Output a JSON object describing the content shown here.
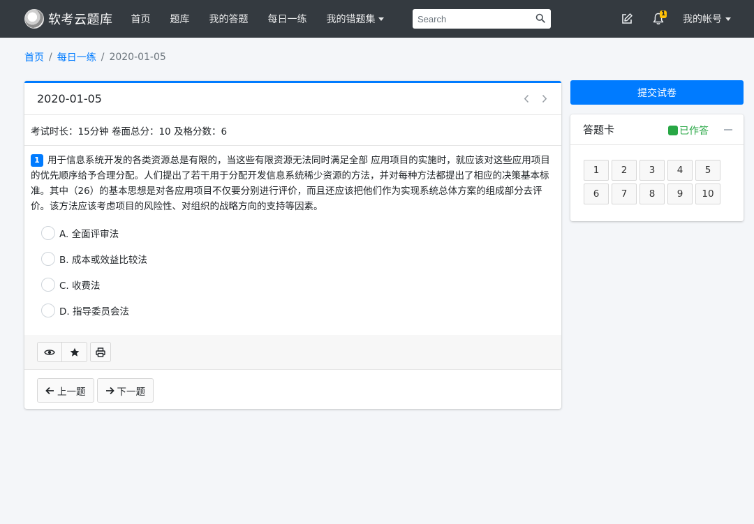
{
  "brand": {
    "name": "软考云题库"
  },
  "nav": [
    {
      "label": "首页"
    },
    {
      "label": "题库"
    },
    {
      "label": "我的答题"
    },
    {
      "label": "每日一练"
    },
    {
      "label": "我的错题集",
      "dropdown": true
    }
  ],
  "search": {
    "placeholder": "Search",
    "value": ""
  },
  "notifications": {
    "count": "1"
  },
  "account": {
    "label": "我的帐号"
  },
  "breadcrumb": [
    {
      "label": "首页"
    },
    {
      "label": "每日一练"
    },
    {
      "label": "2020-01-05"
    }
  ],
  "exam": {
    "title": "2020-01-05",
    "info": "考试时长：15分钟 卷面总分：10 及格分数：6"
  },
  "question": {
    "number": "1",
    "text": "用于信息系统开发的各类资源总是有限的，当这些有限资源无法同时满足全部 应用项目的实施时，就应该对这些应用项目的优先顺序给予合理分配。人们提出了若干用于分配开发信息系统稀少资源的方法，并对每种方法都提出了相应的决策基本标准。其中（26）的基本思想是对各应用项目不仅要分别进行评价，而且还应该把他们作为实现系统总体方案的组成部分去评价。该方法应该考虑项目的风险性、对组织的战略方向的支持等因素。",
    "options": [
      {
        "label": "A. 全面评审法"
      },
      {
        "label": "B. 成本或效益比较法"
      },
      {
        "label": "C. 收费法"
      },
      {
        "label": "D. 指导委员会法"
      }
    ]
  },
  "buttons": {
    "prev": "上一题",
    "next": "下一题",
    "submit": "提交试卷"
  },
  "answer_card": {
    "title": "答题卡",
    "status": "已作答",
    "status_color": "#28a745",
    "numbers": [
      "1",
      "2",
      "3",
      "4",
      "5",
      "6",
      "7",
      "8",
      "9",
      "10"
    ]
  },
  "colors": {
    "primary": "#007bff",
    "navbar": "#343a40",
    "background": "#f4f6f9",
    "badge": "#ffc107"
  },
  "icons": [
    "brand-logo",
    "search-icon",
    "edit-icon",
    "bell-icon",
    "chevron-left-icon",
    "chevron-right-icon",
    "eye-icon",
    "star-icon",
    "print-icon",
    "arrow-left-icon",
    "arrow-right-icon",
    "minus-icon"
  ]
}
